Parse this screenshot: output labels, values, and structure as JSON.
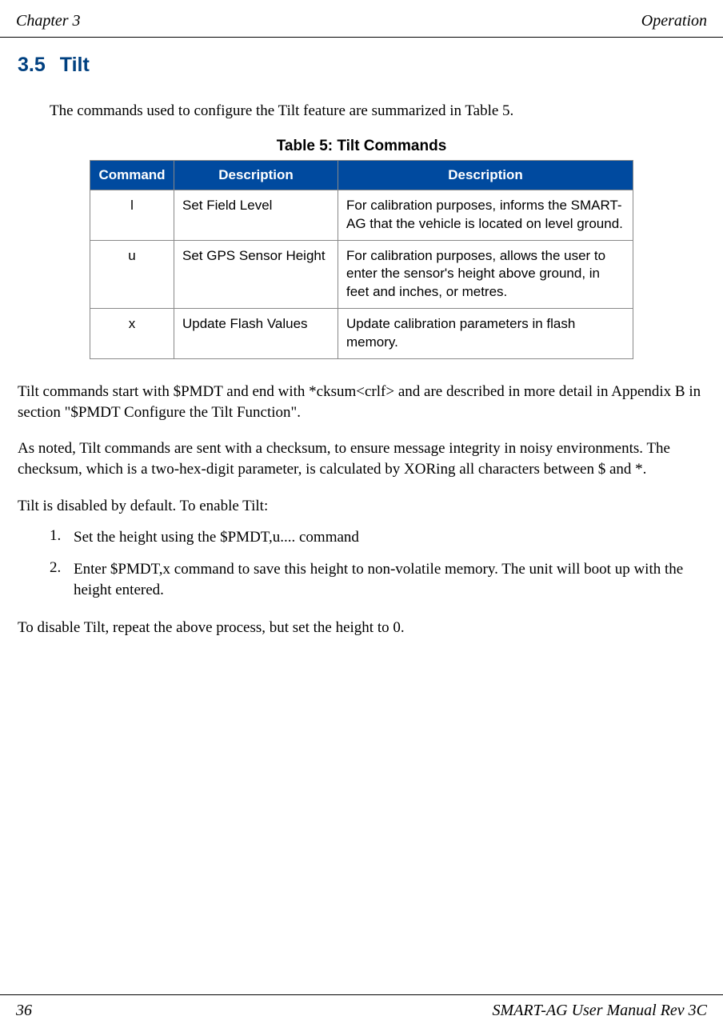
{
  "header": {
    "left": "Chapter 3",
    "right": "Operation"
  },
  "section": {
    "number": "3.5",
    "title": "Tilt"
  },
  "intro": "The commands used to configure the Tilt feature are summarized in Table 5.",
  "table": {
    "caption": "Table 5:  Tilt Commands",
    "headers": [
      "Command",
      "Description",
      "Description"
    ],
    "rows": [
      {
        "command": "l",
        "desc1": "Set Field Level",
        "desc2": "For calibration purposes, informs the SMART-AG that the vehicle is located on level ground."
      },
      {
        "command": "u",
        "desc1": "Set GPS Sensor Height",
        "desc2": "For calibration purposes, allows the user to enter the sensor's height above ground, in feet and inches, or metres."
      },
      {
        "command": "x",
        "desc1": "Update Flash Values",
        "desc2": "Update calibration parameters in flash memory."
      }
    ]
  },
  "para1": "Tilt commands start with $PMDT and end with *cksum<crlf> and are described in more detail in Appendix B in section \"$PMDT Configure the Tilt Function\".",
  "para2": "As noted, Tilt commands are sent with a checksum, to ensure message integrity in noisy environments. The checksum, which is a two-hex-digit parameter, is calculated by XORing all characters between $ and *.",
  "para3": "Tilt is disabled by default. To enable Tilt:",
  "list": [
    {
      "num": "1.",
      "text": "Set the height using the $PMDT,u.... command"
    },
    {
      "num": "2.",
      "text": "Enter $PMDT,x command to save this height to non-volatile memory. The unit will boot up with the height entered."
    }
  ],
  "para4": "To disable Tilt, repeat the above process, but set the height to 0.",
  "footer": {
    "left": "36",
    "right": "SMART-AG User Manual Rev 3C"
  }
}
